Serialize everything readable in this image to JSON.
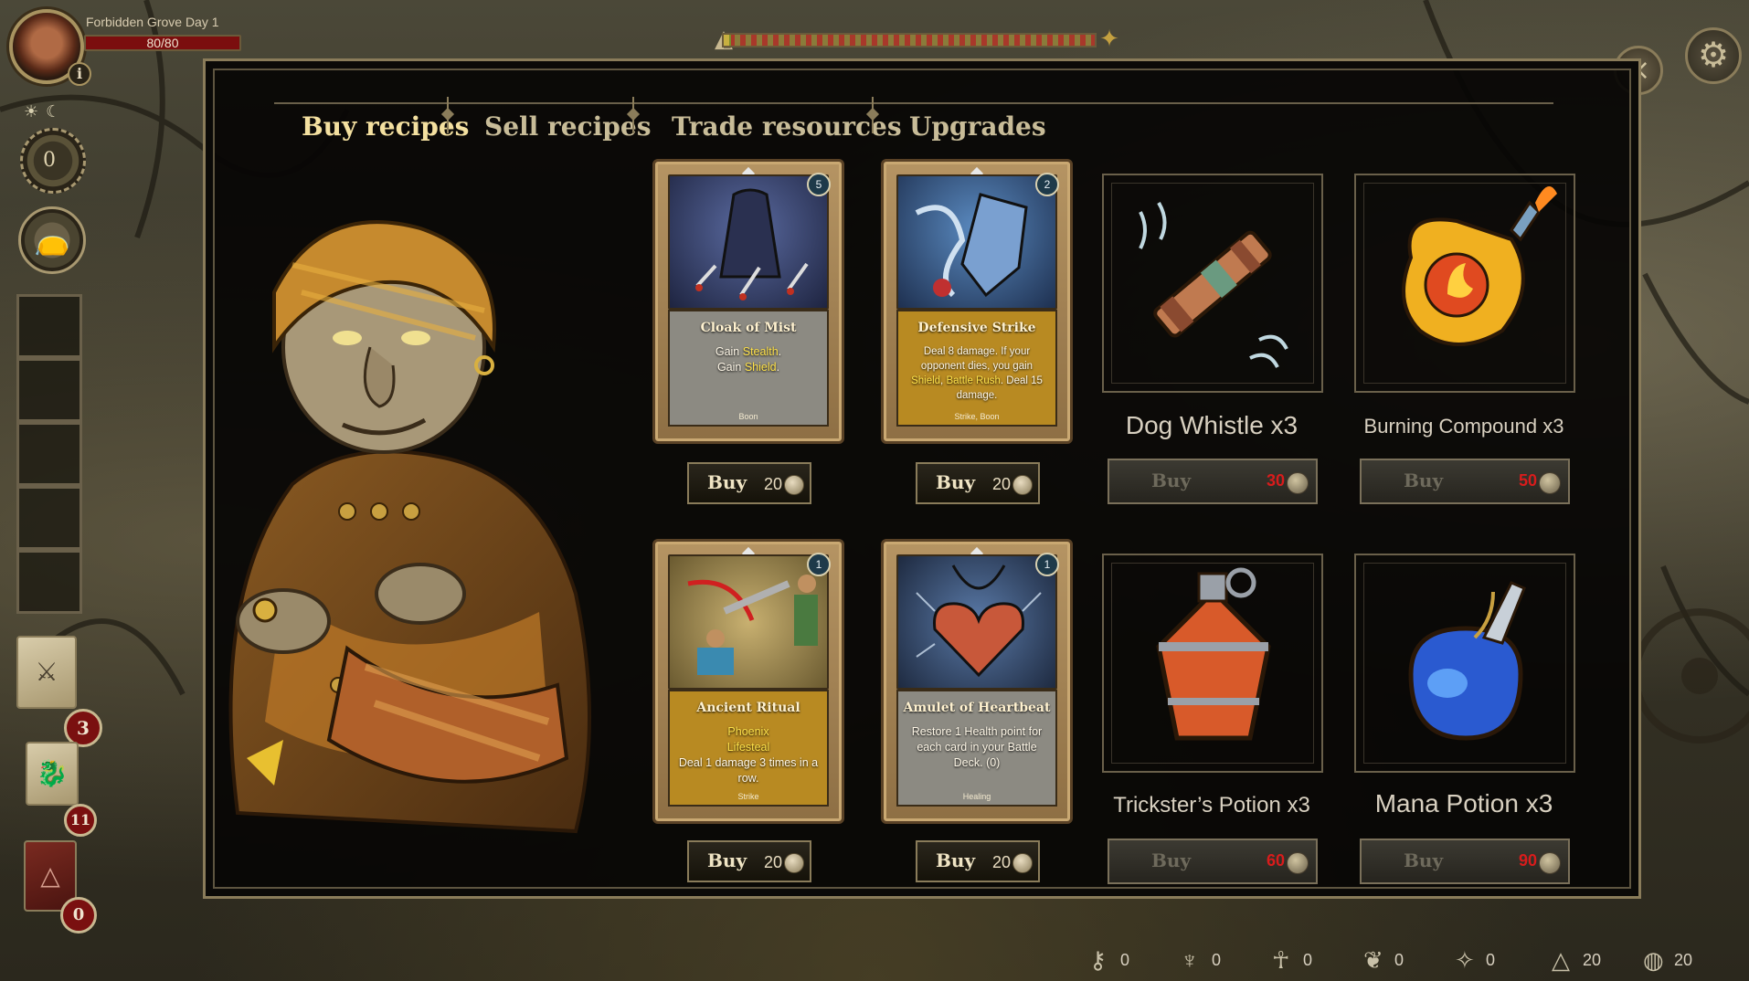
{
  "hud": {
    "location": "Forbidden Grove Day 1",
    "hp": "80/80",
    "hp_fraction": 1.0,
    "turn_counter": "0",
    "day_progress_fraction": 0.02
  },
  "sidebar": {
    "deck_badges": [
      "3",
      "11",
      "0"
    ]
  },
  "tabs": [
    "Buy recipes",
    "Sell recipes",
    "Trade resources",
    "Upgrades"
  ],
  "recipes": [
    {
      "title": "Cloak of Mist",
      "cost": "5",
      "desc_parts": [
        [
          "Gain ",
          false
        ],
        [
          "Stealth",
          true
        ],
        [
          ".",
          false
        ]
      ],
      "desc2": [
        [
          "Gain ",
          false
        ],
        [
          "Shield",
          true
        ],
        [
          ".",
          false
        ]
      ],
      "tag": "Boon",
      "style": "grey",
      "buy_label": "Buy",
      "price": "20"
    },
    {
      "title": "Defensive Strike",
      "cost": "2",
      "tag": "Strike, Boon",
      "style": "gold",
      "buy_label": "Buy",
      "price": "20"
    },
    {
      "title": "Ancient Ritual",
      "cost": "1",
      "tag": "Strike",
      "style": "gold",
      "buy_label": "Buy",
      "price": "20"
    },
    {
      "title": "Amulet of Heartbeat",
      "cost": "1",
      "tag": "Healing",
      "style": "grey",
      "buy_label": "Buy",
      "price": "20"
    }
  ],
  "recipe_text": {
    "cloak_l1a": "Gain ",
    "cloak_l1b": "Stealth",
    "cloak_l1c": ".",
    "cloak_l2a": "Gain ",
    "cloak_l2b": "Shield",
    "cloak_l2c": ".",
    "def_l1": "Deal 8 damage. If your opponent dies, you gain",
    "def_kw1": "Shield",
    "def_sep": ", ",
    "def_kw2": "Battle Rush",
    "def_l2": ". Deal 15 damage.",
    "ritual_kw1": "Phoenix",
    "ritual_kw2": "Lifesteal",
    "ritual_l": "Deal 1 damage 3 times in a row.",
    "amulet_l": "Restore 1 Health point for each card in your Battle Deck. (0)"
  },
  "items": [
    {
      "name": "Dog Whistle x3",
      "buy_label": "Buy",
      "price": "30"
    },
    {
      "name": "Burning Compound x3",
      "buy_label": "Buy",
      "price": "50"
    },
    {
      "name": "Trickster’s Potion x3",
      "buy_label": "Buy",
      "price": "60"
    },
    {
      "name": "Mana Potion x3",
      "buy_label": "Buy",
      "price": "90"
    }
  ],
  "resources": [
    {
      "icon": "key-icon",
      "value": "0"
    },
    {
      "icon": "chalice-icon",
      "value": "0"
    },
    {
      "icon": "ankh-icon",
      "value": "0"
    },
    {
      "icon": "herb-icon",
      "value": "0"
    },
    {
      "icon": "crystal-icon",
      "value": "0"
    },
    {
      "icon": "pyramid-icon",
      "value": "20"
    },
    {
      "icon": "coin-icon",
      "value": "20"
    }
  ],
  "colors": {
    "accent_gold": "#f4e0a0",
    "price_red": "#d81c1c",
    "keyword_yellow": "#ffe24a",
    "hp_red": "#7b0e0e"
  }
}
